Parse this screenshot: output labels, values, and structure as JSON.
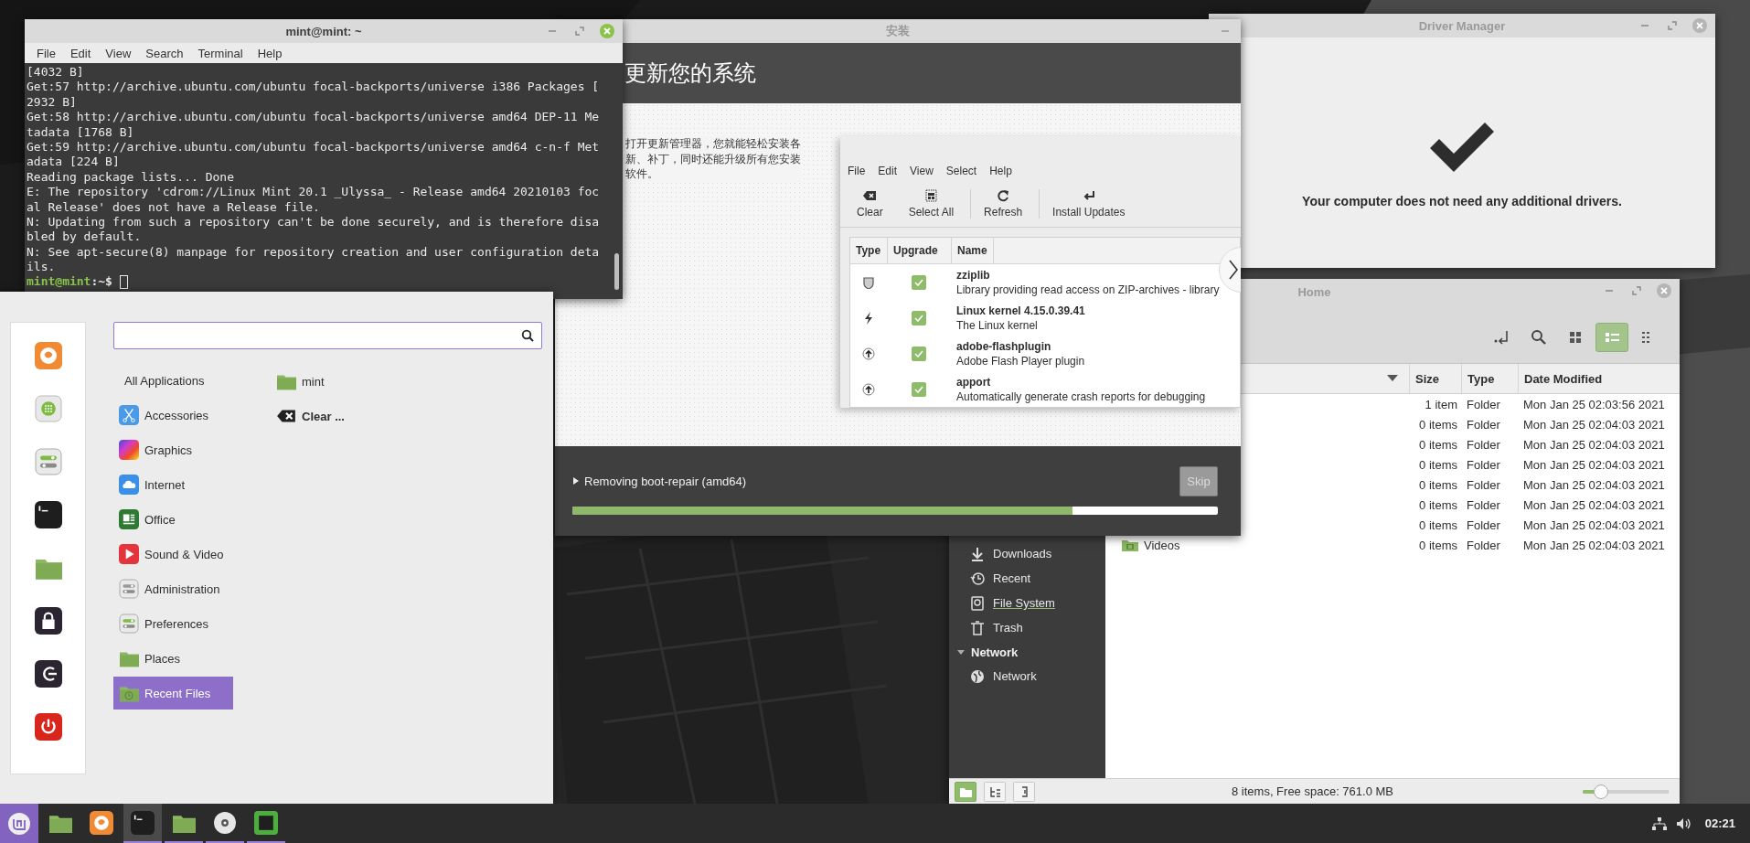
{
  "driver_manager": {
    "title": "Driver Manager",
    "message": "Your computer does not need any additional drivers."
  },
  "file_manager": {
    "title": "Home",
    "toolbar": [
      {
        "kind": "location",
        "selected": false
      },
      {
        "kind": "search",
        "selected": false
      },
      {
        "kind": "icons",
        "selected": false
      },
      {
        "kind": "list",
        "selected": true
      },
      {
        "kind": "compact",
        "selected": false
      }
    ],
    "columns": [
      "Size",
      "Type",
      "Date Modified"
    ],
    "rows": [
      {
        "size": "1 item",
        "type": "Folder",
        "modified": "Mon Jan 25 02:03:56 2021"
      },
      {
        "size": "0 items",
        "type": "Folder",
        "modified": "Mon Jan 25 02:04:03 2021"
      },
      {
        "size": "0 items",
        "type": "Folder",
        "modified": "Mon Jan 25 02:04:03 2021"
      },
      {
        "size": "0 items",
        "type": "Folder",
        "modified": "Mon Jan 25 02:04:03 2021"
      },
      {
        "size": "0 items",
        "type": "Folder",
        "modified": "Mon Jan 25 02:04:03 2021"
      },
      {
        "size": "0 items",
        "type": "Folder",
        "modified": "Mon Jan 25 02:04:03 2021"
      },
      {
        "size": "0 items",
        "type": "Folder",
        "modified": "Mon Jan 25 02:04:03 2021"
      },
      {
        "name": "Videos",
        "size": "0 items",
        "type": "Folder",
        "modified": "Mon Jan 25 02:04:03 2021"
      }
    ],
    "sidebar": [
      {
        "kind": "downloads",
        "label": "Downloads",
        "hovered": false
      },
      {
        "kind": "recent",
        "label": "Recent",
        "hovered": false
      },
      {
        "kind": "filesystem",
        "label": "File System",
        "hovered": true
      },
      {
        "kind": "trash",
        "label": "Trash",
        "hovered": false
      },
      {
        "kind": "header",
        "label": "Network",
        "expanded": true
      },
      {
        "kind": "network",
        "label": "Network",
        "hovered": false
      }
    ],
    "status_buttons": [
      {
        "kind": "places",
        "selected": true
      },
      {
        "kind": "tree",
        "selected": false
      },
      {
        "kind": "sidebar",
        "selected": false
      }
    ],
    "status": "8 items, Free space: 761.0 MB",
    "zoom": {
      "level": 0.2
    }
  },
  "installer": {
    "title": "安装",
    "heading": "更新您的系统",
    "description": "打开更新管理器，您就能轻松安装各新、补丁，同时还能升级所有您安装软件。",
    "slide": {
      "menu": [
        "File",
        "Edit",
        "View",
        "Select",
        "Help"
      ],
      "toolbar": [
        {
          "kind": "clear",
          "label": "Clear",
          "separated": false
        },
        {
          "kind": "select-all",
          "label": "Select All",
          "separated": false
        },
        {
          "kind": "refresh",
          "label": "Refresh",
          "separated": true
        },
        {
          "kind": "install",
          "label": "Install Updates",
          "separated": true
        }
      ],
      "columns": [
        "Type",
        "Upgrade",
        "Name"
      ],
      "updates": [
        {
          "kind": "security",
          "checked": true,
          "name": "zziplib",
          "description": "Library providing read access on ZIP-archives - library"
        },
        {
          "kind": "kernel",
          "checked": true,
          "name": "Linux kernel 4.15.0.39.41",
          "description": "The Linux kernel"
        },
        {
          "kind": "package",
          "checked": true,
          "name": "adobe-flashplugin",
          "description": "Adobe Flash Player plugin"
        },
        {
          "kind": "package",
          "checked": true,
          "name": "apport",
          "description": "Automatically generate crash reports for debugging"
        }
      ]
    },
    "status": "Removing boot-repair (amd64)",
    "expanded": false,
    "progress": {
      "level": 0.775
    },
    "skip": {
      "label": "Skip",
      "disabled": true
    }
  },
  "terminal": {
    "title": "mint@mint: ~",
    "menu": [
      "File",
      "Edit",
      "View",
      "Search",
      "Terminal",
      "Help"
    ],
    "lines": [
      "[4032 B]",
      "Get:57 http://archive.ubuntu.com/ubuntu focal-backports/universe i386 Packages [",
      "2932 B]",
      "Get:58 http://archive.ubuntu.com/ubuntu focal-backports/universe amd64 DEP-11 Me",
      "tadata [1768 B]",
      "Get:59 http://archive.ubuntu.com/ubuntu focal-backports/universe amd64 c-n-f Met",
      "adata [224 B]",
      "Reading package lists... Done",
      "E: The repository 'cdrom://Linux Mint 20.1 _Ulyssa_ - Release amd64 20210103 foc",
      "al Release' does not have a Release file.",
      "N: Updating from such a repository can't be done securely, and is therefore disa",
      "bled by default.",
      "N: See apt-secure(8) manpage for repository creation and user configuration deta",
      "ils."
    ],
    "prompt": {
      "user": "mint@mint",
      "path": ":~$"
    }
  },
  "menu": {
    "favorites": [
      {
        "kind": "firefox"
      },
      {
        "kind": "apps"
      },
      {
        "kind": "settings"
      },
      {
        "kind": "terminal"
      },
      {
        "kind": "folder"
      },
      {
        "kind": "lock"
      },
      {
        "kind": "logout"
      },
      {
        "kind": "power"
      }
    ],
    "categories": [
      {
        "kind": "all",
        "label": "All Applications",
        "selected": false
      },
      {
        "kind": "accessories",
        "label": "Accessories",
        "selected": false
      },
      {
        "kind": "graphics",
        "label": "Graphics",
        "selected": false
      },
      {
        "kind": "internet",
        "label": "Internet",
        "selected": false
      },
      {
        "kind": "office",
        "label": "Office",
        "selected": false
      },
      {
        "kind": "sound",
        "label": "Sound & Video",
        "selected": false
      },
      {
        "kind": "administration",
        "label": "Administration",
        "selected": false
      },
      {
        "kind": "preferences",
        "label": "Preferences",
        "selected": false
      },
      {
        "kind": "places",
        "label": "Places",
        "selected": false
      },
      {
        "kind": "recent",
        "label": "Recent Files",
        "selected": true
      }
    ],
    "entries": [
      {
        "kind": "folder",
        "label": "mint"
      },
      {
        "kind": "clear",
        "label": "Clear ..."
      }
    ]
  },
  "taskbar": {
    "items": [
      {
        "kind": "files",
        "running": false,
        "selected": false
      },
      {
        "kind": "firefox",
        "running": false,
        "selected": false
      },
      {
        "kind": "terminal",
        "running": true,
        "selected": true
      },
      {
        "kind": "folder",
        "running": true,
        "selected": false
      },
      {
        "kind": "disc",
        "running": true,
        "selected": false
      },
      {
        "kind": "installer",
        "running": true,
        "selected": false
      }
    ],
    "clock": "02:21"
  }
}
